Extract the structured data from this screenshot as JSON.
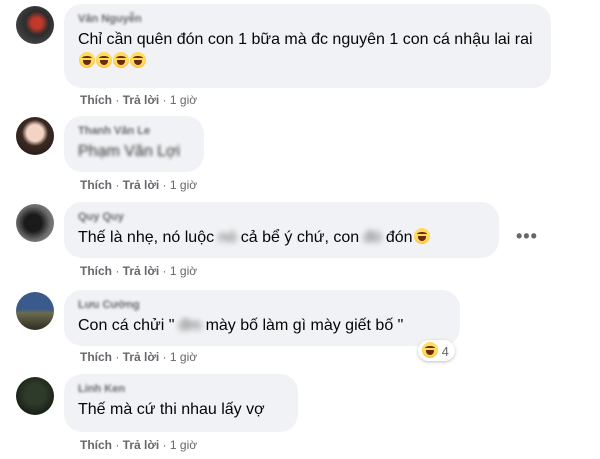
{
  "colors": {
    "bubble": "#f0f2f5",
    "meta_text": "#65676b",
    "text": "#050505"
  },
  "comments": [
    {
      "author": "Văn Nguyễn",
      "text": "Chỉ cần quên đón con 1 bữa mà đc nguyên 1 con cá nhậu lai rai",
      "emoji": "4x laughing-face",
      "like": "Thích",
      "reply": "Trả lời",
      "time": "1 giờ"
    },
    {
      "author": "Thanh Văn Le",
      "text": "Phạm Văn Lợi",
      "like": "Thích",
      "reply": "Trả lời",
      "time": "1 giờ"
    },
    {
      "author": "Quy Quy",
      "text_a": "Thế là nhẹ, nó luộc",
      "text_hidden1": "nó",
      "text_b": "cả bể ý chứ, con",
      "text_hidden2": "đó",
      "text_c": "đón",
      "like": "Thích",
      "reply": "Trả lời",
      "time": "1 giờ"
    },
    {
      "author": "Lưu Cường",
      "text_a": "Con cá chửi \"",
      "text_hidden": "đm",
      "text_b": "mày bố làm gì mày giết bố \"",
      "reaction_count": "4",
      "like": "Thích",
      "reply": "Trả lời",
      "time": "1 giờ"
    },
    {
      "author": "Linh Ken",
      "text": "Thế mà cứ thi nhau lấy vợ",
      "like": "Thích",
      "reply": "Trả lời",
      "time": "1 giờ"
    }
  ],
  "more_menu": "•••"
}
